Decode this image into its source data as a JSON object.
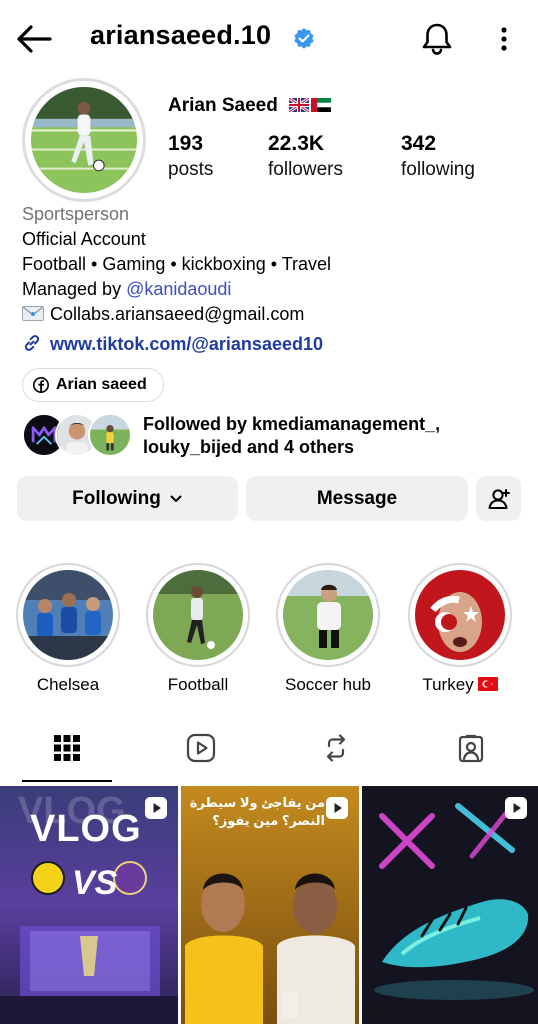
{
  "header": {
    "username": "ariansaeed.10"
  },
  "profile": {
    "full_name": "Arian Saeed",
    "stats": {
      "posts_count": "193",
      "posts_label": "posts",
      "followers_count": "22.3K",
      "followers_label": "followers",
      "following_count": "342",
      "following_label": "following"
    },
    "category": "Sportsperson",
    "bio_lines": [
      "Official Account",
      "Football • Gaming • kickboxing • Travel"
    ],
    "managed_prefix": "Managed by ",
    "managed_mention": "@kanidaoudi",
    "email": "Collabs.ariansaeed@gmail.com",
    "link": "www.tiktok.com/@ariansaeed10",
    "facebook_chip": "Arian saeed"
  },
  "followed_by": {
    "line1": "Followed by kmediamanagement_,",
    "line2": "louky_bijed and 4 others"
  },
  "actions": {
    "following_label": "Following",
    "message_label": "Message"
  },
  "highlights": [
    {
      "label": "Chelsea"
    },
    {
      "label": "Football"
    },
    {
      "label": "Soccer hub"
    },
    {
      "label": "Turkey"
    }
  ],
  "posts": {
    "post1_title": "VLOG",
    "post1_vs": "VS",
    "post2_arabic": "من يفاجئ ولا سيطرة النصر؟ مين يفوز؟"
  },
  "colors": {
    "verified_blue": "#3897f0",
    "link_blue": "#1f3b9f",
    "mention_blue": "#3a4fc4",
    "button_gray": "#eff0f2"
  },
  "icons": {
    "tabs": [
      "grid-icon",
      "reels-icon",
      "reposts-icon",
      "tagged-icon"
    ]
  }
}
